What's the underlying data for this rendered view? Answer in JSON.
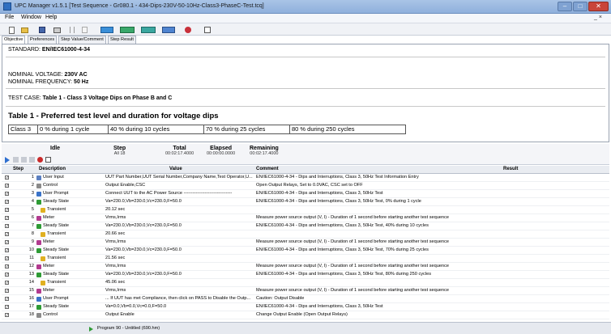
{
  "window": {
    "title": "UPC Manager v1.5.1   [Test Sequence - Gr080.1 - 434-Dips-230V-50-10Hz-Class3-PhaseC-Test.tcq]",
    "minimize": "–",
    "maximize": "□",
    "close": "✕"
  },
  "menu": {
    "items": [
      "File",
      "Window",
      "Help"
    ],
    "right_controls": "_  ×"
  },
  "toolbar": {
    "buttons": [
      "new-icon",
      "open-icon",
      "save-icon",
      "print-icon",
      "cut-icon",
      "copy-icon",
      "run-icon",
      "step-icon",
      "stop-icon",
      "config-icon",
      "report-icon",
      "abort-icon",
      "help-icon"
    ]
  },
  "tabs": [
    "Objective",
    "Preferences",
    "Step Value/Comment",
    "Step Result"
  ],
  "objective": {
    "standard_label": "STANDARD:",
    "standard_value": "EN/IEC61000-4-34",
    "voltage_label": "NOMINAL VOLTAGE:",
    "voltage_value": "230V AC",
    "frequency_label": "NOMINAL FREQUENCY:",
    "frequency_value": "50 Hz",
    "testcase_label": "TEST CASE:",
    "testcase_value": "Table 1 - Class 3 Voltage Dips on Phase B and C",
    "table_title": "Table 1 - Preferred test level and duration for voltage dips",
    "table_cells": [
      "Class 3",
      "0 % during 1 cycle",
      "40 % during 10 cycles",
      "70 % during 25 cycles",
      "80 % during 250 cycles"
    ]
  },
  "status": {
    "idle_label": "Idle",
    "step_label": "Step",
    "step_value": "All 18",
    "total_label": "Total",
    "total_value": "00:02:17.4000",
    "elapsed_label": "Elapsed",
    "elapsed_value": "00:00:00.0000",
    "remaining_label": "Remaining",
    "remaining_value": "00:02:17.4000"
  },
  "grid": {
    "headers": {
      "step": "Step",
      "description": "Description",
      "value": "Value",
      "comment": "Comment",
      "result": "Result"
    },
    "rows": [
      {
        "step": "1",
        "desc": "User Input",
        "icon": "user-input-icon",
        "color": "#5b7fc1",
        "value": "UUT Part Number,UUT Serial Number,Company Name,Test Operator,U...",
        "comment": "EN/IEC61000-4-34 - Dips and Interruptions, Class 3, 50Hz Test Information Entry"
      },
      {
        "step": "2",
        "desc": "Control",
        "icon": "control-icon",
        "color": "#8a8a8a",
        "value": "Output Enable,CSC",
        "comment": "Open Output Relays, Set to 0.0VAC, CSC set to OFF"
      },
      {
        "step": "3",
        "desc": "User Prompt",
        "icon": "user-prompt-icon",
        "color": "#3a73c8",
        "value": "Connect  UUT to the AC Power Source --------------------------------",
        "comment": "EN/IEC61000-4-34 - Dips and Interruptions, Class 3, 50Hz Test"
      },
      {
        "step": "4",
        "desc": "Steady State",
        "icon": "steady-state-icon",
        "color": "#2e9b35",
        "value": "Va=230.0,Vb=230.0,Vc=230.0,F=50.0",
        "comment": "EN/IEC61000-4-34 - Dips and Interruptions, Class 3, 50Hz Test, 0% during 1 cycle"
      },
      {
        "step": "5",
        "desc": "Transient",
        "icon": "transient-icon",
        "color": "#e0b020",
        "value": "20.12 sec",
        "comment": ""
      },
      {
        "step": "6",
        "desc": "Meter",
        "icon": "meter-icon",
        "color": "#b23a8f",
        "value": "Vrms,Irms",
        "comment": "Measure power source output (V, I) - Duration of 1 second before starting another test sequence"
      },
      {
        "step": "7",
        "desc": "Steady State",
        "icon": "steady-state-icon",
        "color": "#2e9b35",
        "value": "Va=230.0,Vb=230.0,Vc=230.0,F=50.0",
        "comment": "EN/IEC61000-4-34 - Dips and Interruptions, Class 3, 50Hz Test, 40% during 10 cycles"
      },
      {
        "step": "8",
        "desc": "Transient",
        "icon": "transient-icon",
        "color": "#e0b020",
        "value": "20.66 sec",
        "comment": ""
      },
      {
        "step": "9",
        "desc": "Meter",
        "icon": "meter-icon",
        "color": "#b23a8f",
        "value": "Vrms,Irms",
        "comment": "Measure power source output (V, I) - Duration of 1 second before starting another test sequence"
      },
      {
        "step": "10",
        "desc": "Steady State",
        "icon": "steady-state-icon",
        "color": "#2e9b35",
        "value": "Va=230.0,Vb=230.0,Vc=230.0,F=50.0",
        "comment": "EN/IEC61000-4-34 - Dips and Interruptions, Class 3, 50Hz Test, 70% during 25 cycles"
      },
      {
        "step": "11",
        "desc": "Transient",
        "icon": "transient-icon",
        "color": "#e0b020",
        "value": "21.56 sec",
        "comment": ""
      },
      {
        "step": "12",
        "desc": "Meter",
        "icon": "meter-icon",
        "color": "#b23a8f",
        "value": "Vrms,Irms",
        "comment": "Measure power source output (V, I) - Duration of 1 second before starting another test sequence"
      },
      {
        "step": "13",
        "desc": "Steady State",
        "icon": "steady-state-icon",
        "color": "#2e9b35",
        "value": "Va=230.0,Vb=230.0,Vc=230.0,F=50.0",
        "comment": "EN/IEC61000-4-34 - Dips and Interruptions, Class 3, 50Hz Test, 80% during 250 cycles"
      },
      {
        "step": "14",
        "desc": "Transient",
        "icon": "transient-icon",
        "color": "#e0b020",
        "value": "45.06 sec",
        "comment": ""
      },
      {
        "step": "15",
        "desc": "Meter",
        "icon": "meter-icon",
        "color": "#b23a8f",
        "value": "Vrms,Irms",
        "comment": "Measure power source output (V, I) - Duration of 1 second before starting another test sequence"
      },
      {
        "step": "16",
        "desc": "User Prompt",
        "icon": "user-prompt-icon",
        "color": "#3a73c8",
        "value": "... If UUT has met Compliance, then click on PASS to Disable the Outp...",
        "comment": "Caution: Output Disable"
      },
      {
        "step": "17",
        "desc": "Steady State",
        "icon": "steady-state-icon",
        "color": "#2e9b35",
        "value": "Va=0.0,Vb=0.0,Vc=0.0,F=50.0",
        "comment": "EN/IEC61000-4-34 - Dips and Interruptions, Class 3, 50Hz Test"
      },
      {
        "step": "18",
        "desc": "Control",
        "icon": "control-icon",
        "color": "#8a8a8a",
        "value": "Output Enable",
        "comment": "Change Output Enable (Open Output Relays)"
      }
    ]
  },
  "statusbar": {
    "text": "Program 90 - Untitled (690.hm)"
  }
}
